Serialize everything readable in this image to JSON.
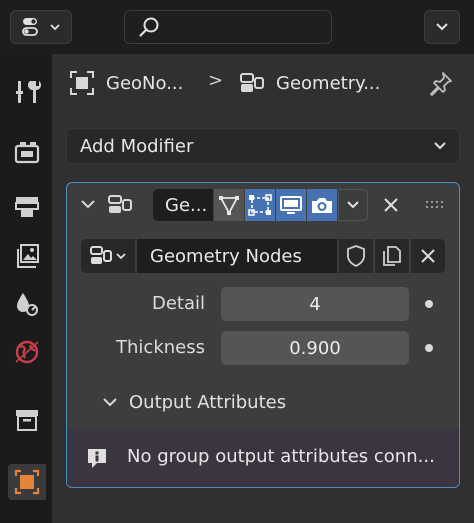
{
  "header": {
    "editor_type_icon": "properties-editor-icon",
    "search_placeholder": "",
    "menu_icon": "chevron-down-icon"
  },
  "sidebar_tabs": [
    {
      "name": "tool",
      "icon": "wrench-screwdriver-icon",
      "active": false
    },
    {
      "name": "render",
      "icon": "render-camera-icon",
      "active": false
    },
    {
      "name": "output",
      "icon": "printer-icon",
      "active": false
    },
    {
      "name": "view-layer",
      "icon": "image-stack-icon",
      "active": false
    },
    {
      "name": "scene",
      "icon": "scene-icon",
      "active": false
    },
    {
      "name": "world",
      "icon": "world-icon",
      "active": false
    },
    {
      "name": "collection",
      "icon": "collection-box-icon",
      "active": false
    },
    {
      "name": "object",
      "icon": "object-square-icon",
      "active": true
    }
  ],
  "breadcrumb": {
    "object_name": "GeoNo...",
    "separator": ">",
    "modifier_name": "Geometry...",
    "pin_icon": "pin-icon"
  },
  "add_modifier": {
    "label": "Add Modifier"
  },
  "modifier": {
    "name": "Ge...",
    "node_group": "Geometry Nodes",
    "toggles": {
      "edit_mode": false,
      "on_cage": true,
      "viewport": true,
      "render": true
    },
    "properties": [
      {
        "label": "Detail",
        "value": "4"
      },
      {
        "label": "Thickness",
        "value": "0.900"
      }
    ],
    "output_attributes_label": "Output Attributes",
    "info_message": "No group output attributes conn..."
  },
  "colors": {
    "accent_blue": "#4772b3",
    "panel_border": "#4b8fbf",
    "active_object_orange": "#e6833a"
  }
}
